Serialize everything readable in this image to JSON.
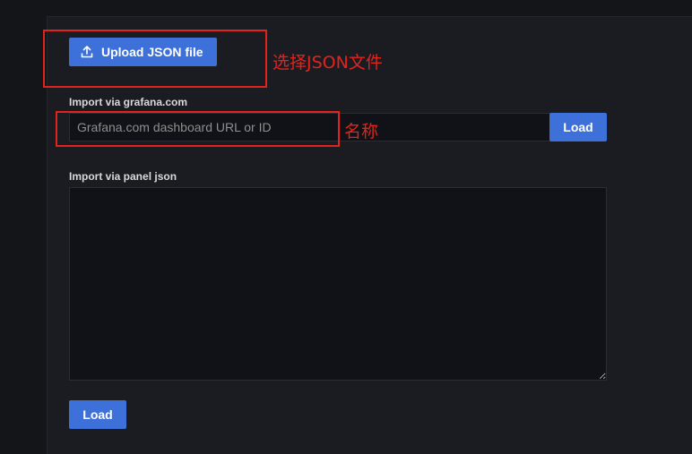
{
  "import": {
    "upload_button_label": "Upload JSON file",
    "upload_icon": "upload-icon",
    "grafana_com_label": "Import via grafana.com",
    "grafana_com_placeholder": "Grafana.com dashboard URL or ID",
    "grafana_com_load_label": "Load",
    "panel_json_label": "Import via panel json",
    "panel_json_value": "",
    "panel_json_load_label": "Load"
  },
  "annotations": {
    "upload_note": "选择JSON文件",
    "input_note": "名称",
    "color": "#e0241d"
  },
  "colors": {
    "primary_button": "#3d71d9",
    "background": "#141518",
    "panel": "#1b1c22"
  }
}
